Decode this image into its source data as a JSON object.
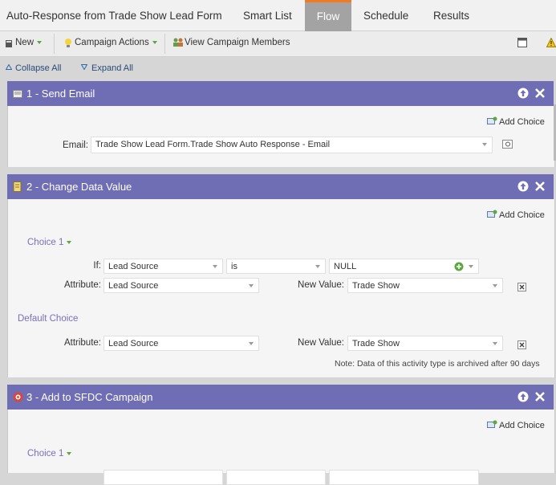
{
  "tabs": {
    "title": "Auto-Response from Trade Show Lead Form",
    "items": [
      "Smart List",
      "Flow",
      "Schedule",
      "Results"
    ],
    "active": "Flow"
  },
  "toolbar": {
    "new_label": "New",
    "campaign_actions_label": "Campaign Actions",
    "view_members_label": "View Campaign Members"
  },
  "collapse": {
    "collapse_all": "Collapse All",
    "expand_all": "Expand All"
  },
  "steps": [
    {
      "title": "1 - Send Email",
      "add_choice": "Add Choice",
      "email_label": "Email:",
      "email_value": "Trade Show Lead Form.Trade Show Auto Response - Email"
    },
    {
      "title": "2 - Change Data Value",
      "add_choice": "Add Choice",
      "choice1_label": "Choice 1",
      "if_label": "If:",
      "if_field": "Lead Source",
      "if_operator": "is",
      "if_value": "NULL",
      "attribute_label": "Attribute:",
      "attribute_value": "Lead Source",
      "new_value_label": "New Value:",
      "new_value": "Trade Show",
      "default_choice_label": "Default Choice",
      "default_attribute_label": "Attribute:",
      "default_attribute_value": "Lead Source",
      "default_new_value_label": "New Value:",
      "default_new_value": "Trade Show",
      "note": "Note: Data of this activity type is archived after 90 days"
    },
    {
      "title": "3 - Add to SFDC Campaign",
      "add_choice": "Add Choice",
      "choice1_label": "Choice 1"
    }
  ],
  "colors": {
    "card_header": "#6f6db4",
    "active_tab": "#a3a3a3",
    "active_tab_accent": "#f47a20",
    "choice_label": "#7a6fb8",
    "green_caret": "#5aa83f"
  }
}
